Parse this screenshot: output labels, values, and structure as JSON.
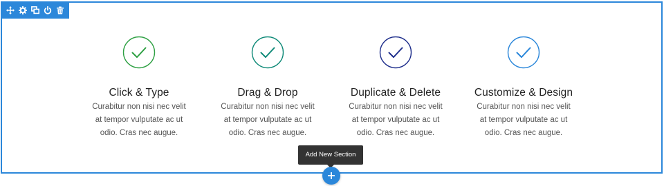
{
  "toolbar": {
    "icons": [
      "move-icon",
      "settings-icon",
      "duplicate-icon",
      "power-icon",
      "trash-icon"
    ]
  },
  "features": [
    {
      "title": "Click & Type",
      "body": "Curabitur non nisi nec velit at tempor vulputate ac ut odio. Cras nec augue.",
      "color": "#2ea043"
    },
    {
      "title": "Drag & Drop",
      "body": "Curabitur non nisi nec velit at tempor vulputate ac ut odio. Cras nec augue.",
      "color": "#0f8a78"
    },
    {
      "title": "Duplicate & Delete",
      "body": "Curabitur non nisi nec velit at tempor vulputate ac ut odio. Cras nec augue.",
      "color": "#1f2f8c"
    },
    {
      "title": "Customize & Design",
      "body": "Curabitur non nisi nec velit at tempor vulputate ac ut odio. Cras nec augue.",
      "color": "#2b87da"
    }
  ],
  "add_section": {
    "tooltip": "Add New Section"
  },
  "colors": {
    "accent": "#2b87da",
    "tooltip_bg": "#333333"
  }
}
